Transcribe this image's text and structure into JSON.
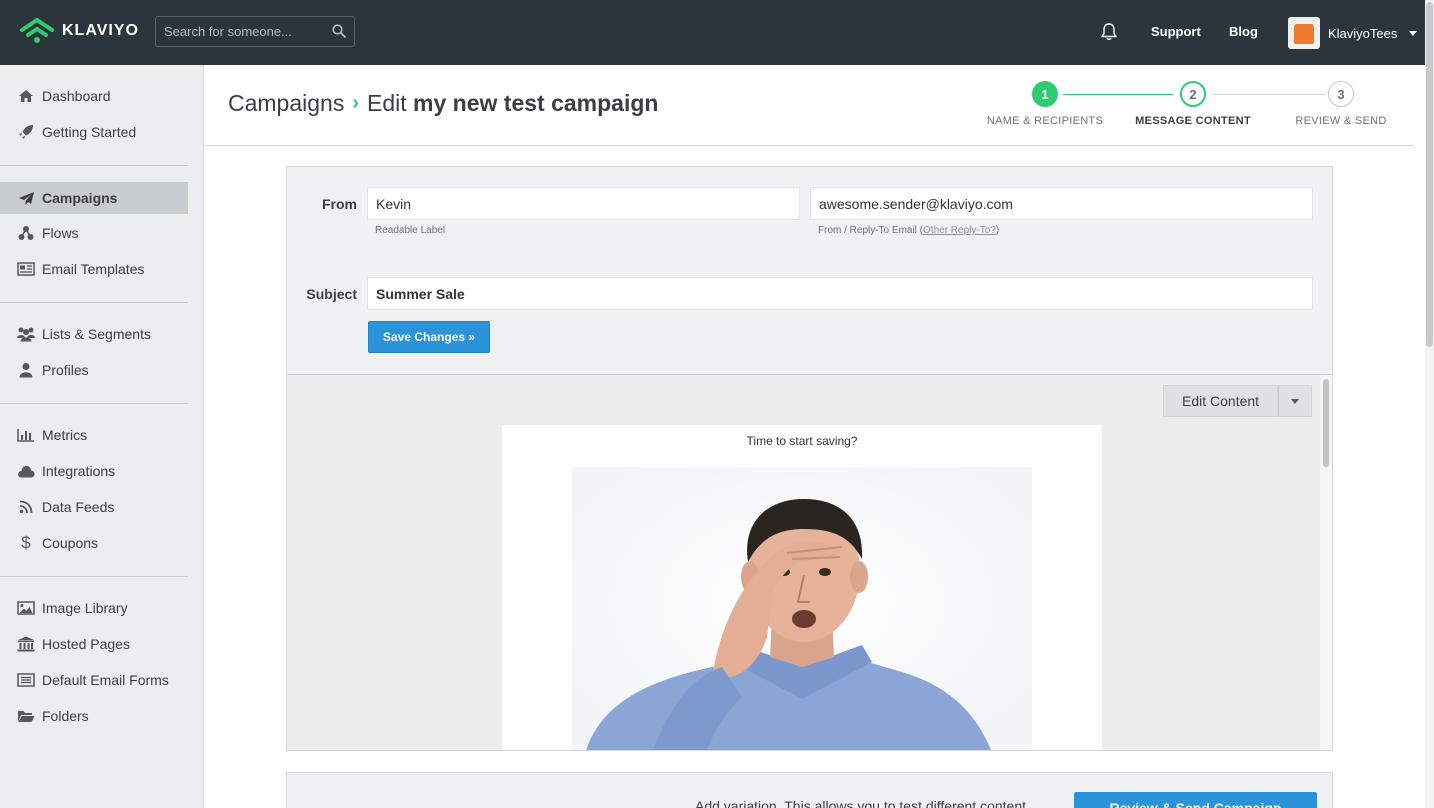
{
  "brand": {
    "name": "KLAVIYO",
    "accent": "#2ecc71",
    "primary_button": "#2b93d8",
    "topbar_bg": "#2d353c"
  },
  "topbar": {
    "search_placeholder": "Search for someone...",
    "support": "Support",
    "blog": "Blog",
    "account_name": "KlaviyoTees"
  },
  "sidebar": {
    "items": [
      {
        "label": "Dashboard",
        "icon": "home-icon"
      },
      {
        "label": "Getting Started",
        "icon": "rocket-icon"
      },
      {
        "label": "Campaigns",
        "icon": "paper-plane-icon",
        "active": true
      },
      {
        "label": "Flows",
        "icon": "flows-icon"
      },
      {
        "label": "Email Templates",
        "icon": "template-icon"
      },
      {
        "label": "Lists & Segments",
        "icon": "users-icon"
      },
      {
        "label": "Profiles",
        "icon": "user-icon"
      },
      {
        "label": "Metrics",
        "icon": "bar-chart-icon"
      },
      {
        "label": "Integrations",
        "icon": "cloud-icon"
      },
      {
        "label": "Data Feeds",
        "icon": "rss-icon"
      },
      {
        "label": "Coupons",
        "icon": "dollar-icon"
      },
      {
        "label": "Image Library",
        "icon": "image-icon"
      },
      {
        "label": "Hosted Pages",
        "icon": "bank-icon"
      },
      {
        "label": "Default Email Forms",
        "icon": "form-icon"
      },
      {
        "label": "Folders",
        "icon": "folder-icon"
      }
    ]
  },
  "header": {
    "section": "Campaigns",
    "separator": "›",
    "action": "Edit",
    "campaign_name": "my new test campaign"
  },
  "steps": [
    {
      "number": "1",
      "label": "NAME & RECIPIENTS",
      "state": "done"
    },
    {
      "number": "2",
      "label": "MESSAGE CONTENT",
      "state": "current"
    },
    {
      "number": "3",
      "label": "REVIEW & SEND",
      "state": "todo"
    }
  ],
  "form": {
    "from_label": "From",
    "from_name_value": "Kevin",
    "from_name_help": "Readable Label",
    "from_email_value": "awesome.sender@klaviyo.com",
    "from_email_help_prefix": "From / Reply-To Email (",
    "from_email_help_link": "Other Reply-To?",
    "from_email_help_suffix": ")",
    "subject_label": "Subject",
    "subject_value": "Summer Sale",
    "save_button": "Save Changes »"
  },
  "preview": {
    "edit_content_button": "Edit Content",
    "preheader_text": "Time to start saving?"
  },
  "footer": {
    "variation_text": "Add variation. This allows you to test different content",
    "review_button": "Review & Send Campaign"
  }
}
